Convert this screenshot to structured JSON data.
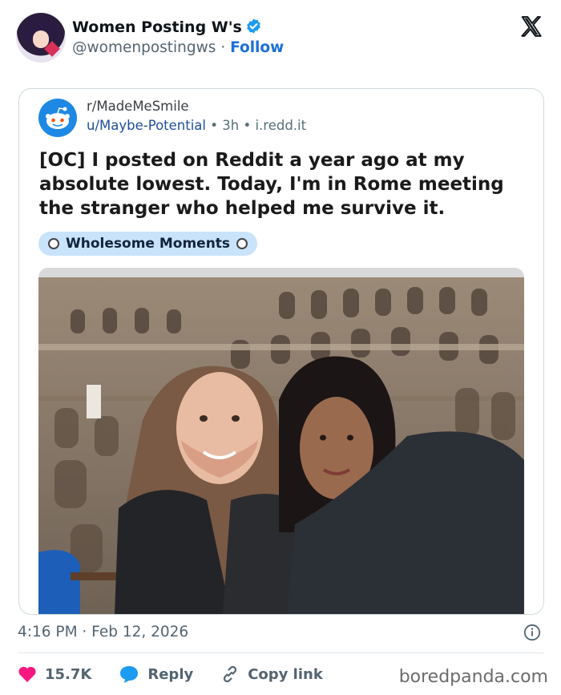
{
  "author": {
    "name": "Women Posting W's",
    "handle": "@womenpostingws",
    "separator": "·",
    "follow_label": "Follow",
    "verified_icon": "verified-badge-icon"
  },
  "embedded_post": {
    "subreddit": "r/MadeMeSmile",
    "username": "u/Maybe-Potential",
    "dot": "•",
    "age": "3h",
    "domain": "i.redd.it",
    "title": "[OC] I posted on Reddit a year ago at my absolute lowest. Today, I'm in Rome meeting the stranger who helped me survive it.",
    "flair": "Wholesome Moments"
  },
  "footer": {
    "timestamp": "4:16 PM · Feb 12, 2026",
    "likes": "15.7K",
    "reply_label": "Reply",
    "copy_link_label": "Copy link"
  },
  "watermark": "boredpanda.com",
  "colors": {
    "like": "#f91880",
    "reply": "#1d9bf0",
    "follow": "#1d6fd6",
    "flair_bg": "#c9e3fb"
  }
}
